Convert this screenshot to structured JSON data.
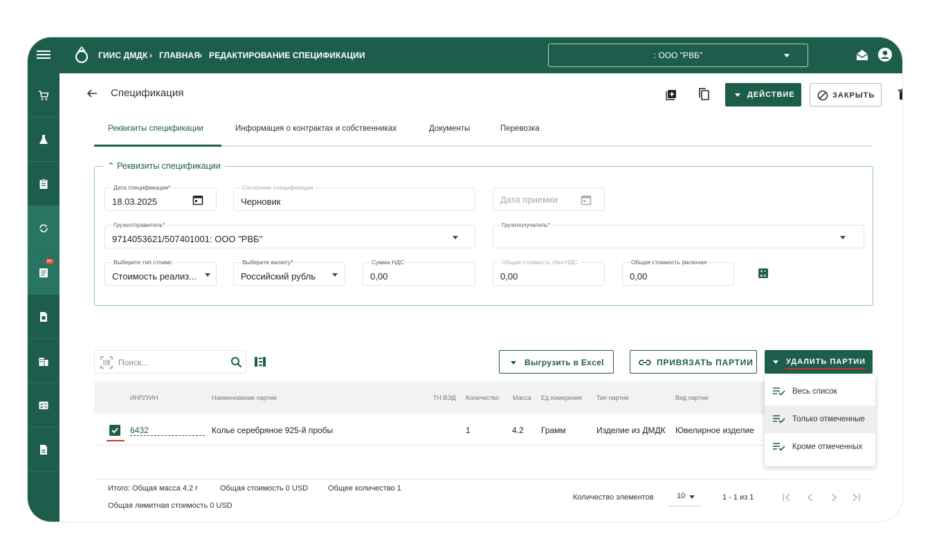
{
  "topbar": {
    "breadcrumb": [
      "ГИИС ДМДК",
      "ГЛАВНАЯ",
      "РЕДАКТИРОВАНИЕ СПЕЦИФИКАЦИИ"
    ],
    "org_select": ": ООО \"РВБ\""
  },
  "sidebar": {
    "badge": "99+"
  },
  "page": {
    "title": "Спецификация",
    "action_button": "ДЕЙСТВИЕ",
    "close_button": "ЗАКРЫТЬ"
  },
  "tabs": [
    {
      "label": "Реквизиты спецификации",
      "active": true
    },
    {
      "label": "Информация о контрактах и собственниках",
      "active": false
    },
    {
      "label": "Документы",
      "active": false
    },
    {
      "label": "Перевозка",
      "active": false
    }
  ],
  "form": {
    "legend": "Реквизиты спецификации",
    "spec_date": {
      "label": "Дата спецификации*",
      "value": "18.03.2025"
    },
    "spec_state": {
      "label": "Состояние спецификации",
      "value": "Черновик"
    },
    "accept_date": {
      "placeholder": "Дата приемки"
    },
    "shipper": {
      "label": "Грузоотправитель*",
      "value": "9714053621/507401001: ООО \"РВБ\""
    },
    "consignee": {
      "label": "Грузополучатель*",
      "value": ""
    },
    "cost_type": {
      "label": "Выберите тип стоимс",
      "value": "Стоимость реализ..."
    },
    "currency": {
      "label": "Выберите валюту*",
      "value": "Российский рубль"
    },
    "vat_sum": {
      "label": "Сумма НДС",
      "value": "0,00"
    },
    "total_no_vat": {
      "label": "Общая стоимость (без НДС",
      "value": "0,00"
    },
    "total_with_vat": {
      "label": "Общая стоимость (включая",
      "value": "0,00"
    }
  },
  "toolbar": {
    "search_placeholder": "Поиск...",
    "export_button": "Выгрузить в Excel",
    "bind_button": "ПРИВЯЗАТЬ ПАРТИИ",
    "delete_button": "УДАЛИТЬ ПАРТИИ"
  },
  "delete_menu": [
    {
      "label": "Весь список",
      "highlighted": false
    },
    {
      "label": "Только отмеченные",
      "highlighted": true
    },
    {
      "label": "Кроме отмеченных",
      "highlighted": false
    }
  ],
  "table": {
    "headers": [
      "ИНП/УИН",
      "Наименование партии",
      "ТН ВЭД",
      "Количество",
      "Масса",
      "Ед измерения",
      "Тип партии",
      "Вид партии"
    ],
    "rows": [
      {
        "checked": true,
        "inp": "6432",
        "name": "Колье серебряное 925-й пробы",
        "tnved": "",
        "qty": "1",
        "mass": "4.2",
        "unit": "Грамм",
        "type": "Изделие из ДМДК",
        "kind": "Ювелирное изделие"
      }
    ]
  },
  "footer": {
    "total_mass": "Итого: Общая масса 4.2 г",
    "total_cost": "Общая стоимость 0 USD",
    "total_qty": "Общее количество 1",
    "limit_cost": "Общая лимитная стоимость 0 USD",
    "items_label": "Количество элементов",
    "page_size": "10",
    "range": "1 - 1 из 1"
  },
  "colors": {
    "brand": "#1d5d4b",
    "accent_border": "#8dc7b7",
    "highlight_red": "#d0302a"
  }
}
